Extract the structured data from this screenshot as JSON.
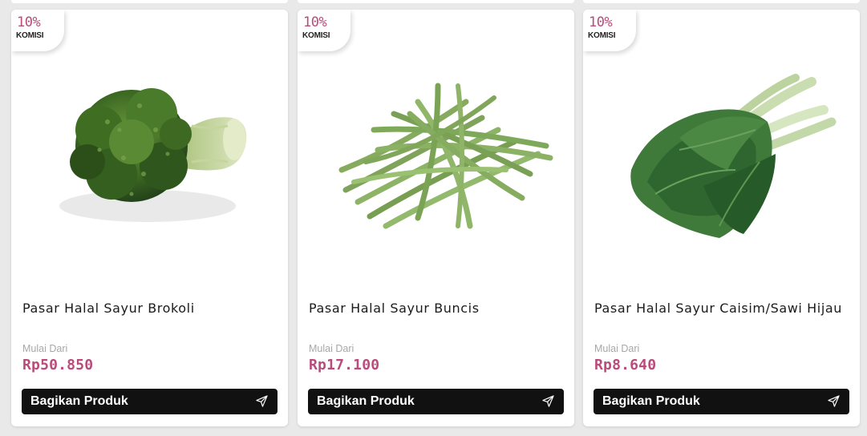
{
  "products": [
    {
      "commission_percent": "10%",
      "commission_label": "KOMISI",
      "image_icon": "broccoli-image",
      "title": "Pasar Halal Sayur Brokoli",
      "price_prefix": "Mulai Dari",
      "price": "Rp50.850",
      "share_label": "Bagikan Produk",
      "share_icon": "send-icon"
    },
    {
      "commission_percent": "10%",
      "commission_label": "KOMISI",
      "image_icon": "green-beans-image",
      "title": "Pasar Halal Sayur Buncis",
      "price_prefix": "Mulai Dari",
      "price": "Rp17.100",
      "share_label": "Bagikan Produk",
      "share_icon": "send-icon"
    },
    {
      "commission_percent": "10%",
      "commission_label": "KOMISI",
      "image_icon": "caisim-image",
      "title": "Pasar Halal Sayur Caisim/Sawi Hijau",
      "price_prefix": "Mulai Dari",
      "price": "Rp8.640",
      "share_label": "Bagikan Produk",
      "share_icon": "send-icon"
    }
  ],
  "colors": {
    "accent": "#b94c7a",
    "button_bg": "#111111",
    "page_bg": "#e9e9e9",
    "card_bg": "#ffffff"
  }
}
